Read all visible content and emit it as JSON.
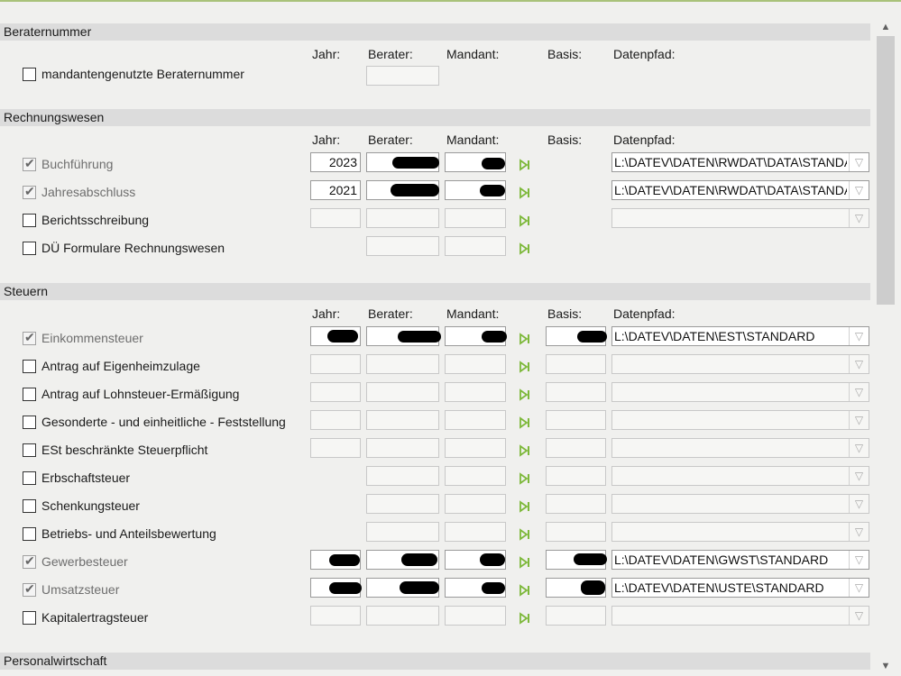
{
  "columns": {
    "jahr": "Jahr:",
    "berater": "Berater:",
    "mandant": "Mandant:",
    "basis": "Basis:",
    "datenpfad": "Datenpfad:"
  },
  "sections": {
    "beraternummer": "Beraternummer",
    "rechnungswesen": "Rechnungswesen",
    "steuern": "Steuern",
    "personalwirtschaft": "Personalwirtschaft"
  },
  "rows": {
    "mandantengenutzte": {
      "label": "mandantengenutzte Beraternummer",
      "checked": false
    },
    "buchfuehrung": {
      "label": "Buchführung",
      "checked": true,
      "jahr": "2023",
      "path": "L:\\DATEV\\DATEN\\RWDAT\\DATA\\STANDA"
    },
    "jahresabschluss": {
      "label": "Jahresabschluss",
      "checked": true,
      "jahr": "2021",
      "path": "L:\\DATEV\\DATEN\\RWDAT\\DATA\\STANDA"
    },
    "berichtsschreibung": {
      "label": "Berichtsschreibung",
      "checked": false
    },
    "due_formulare": {
      "label": "DÜ Formulare Rechnungswesen",
      "checked": false
    },
    "einkommensteuer": {
      "label": "Einkommensteuer",
      "checked": true,
      "path": "L:\\DATEV\\DATEN\\EST\\STANDARD"
    },
    "eigenheimzulage": {
      "label": "Antrag auf Eigenheimzulage",
      "checked": false
    },
    "lohnsteuer": {
      "label": "Antrag auf Lohnsteuer-Ermäßigung",
      "checked": false
    },
    "feststellung": {
      "label": "Gesonderte - und einheitliche - Feststellung",
      "checked": false
    },
    "est_beschraenkt": {
      "label": "ESt beschränkte Steuerpflicht",
      "checked": false
    },
    "erbschaftsteuer": {
      "label": "Erbschaftsteuer",
      "checked": false
    },
    "schenkungsteuer": {
      "label": "Schenkungsteuer",
      "checked": false
    },
    "betriebsbewertung": {
      "label": "Betriebs- und Anteilsbewertung",
      "checked": false
    },
    "gewerbesteuer": {
      "label": "Gewerbesteuer",
      "checked": true,
      "path": "L:\\DATEV\\DATEN\\GWST\\STANDARD"
    },
    "umsatzsteuer": {
      "label": "Umsatzsteuer",
      "checked": true,
      "path": "L:\\DATEV\\DATEN\\USTE\\STANDARD"
    },
    "kapitalertragsteuer": {
      "label": "Kapitalertragsteuer",
      "checked": false
    }
  },
  "icons": {
    "go": "play-next-icon",
    "combo": "chevron-down-icon",
    "scroll_up": "arrow-up-icon",
    "scroll_down": "arrow-down-icon"
  },
  "colors": {
    "accent_line": "#a9c27a",
    "section_bg": "#dcdcdc",
    "go_icon": "#7db83a"
  }
}
